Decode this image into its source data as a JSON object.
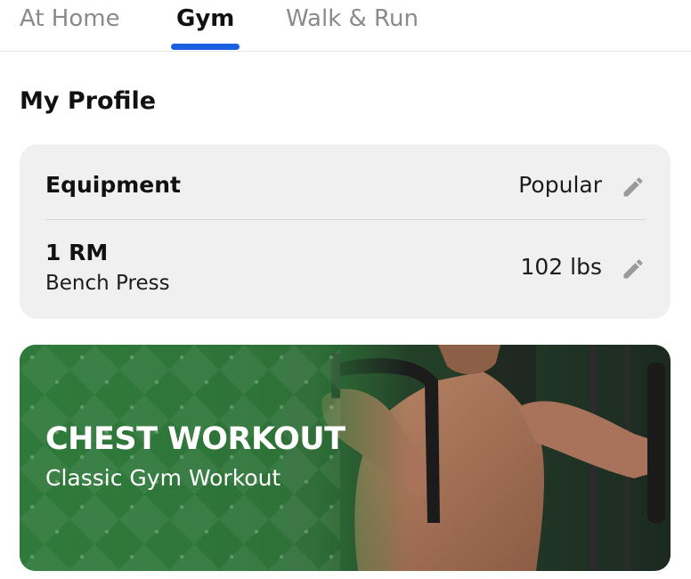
{
  "tabs": [
    {
      "label": "At Home",
      "active": false
    },
    {
      "label": "Gym",
      "active": true
    },
    {
      "label": "Walk & Run",
      "active": false
    }
  ],
  "colors": {
    "accent": "#1b5fe0",
    "card_background": "#f0f0f0",
    "banner_green": "#2f7a3b"
  },
  "profile": {
    "title": "My Profile",
    "equipment": {
      "label": "Equipment",
      "value": "Popular",
      "icon": "pencil-icon"
    },
    "one_rm": {
      "label": "1 RM",
      "sublabel": "Bench Press",
      "value": "102 lbs",
      "icon": "pencil-icon"
    }
  },
  "workout": {
    "title": "CHEST WORKOUT",
    "subtitle": "Classic Gym Workout"
  }
}
